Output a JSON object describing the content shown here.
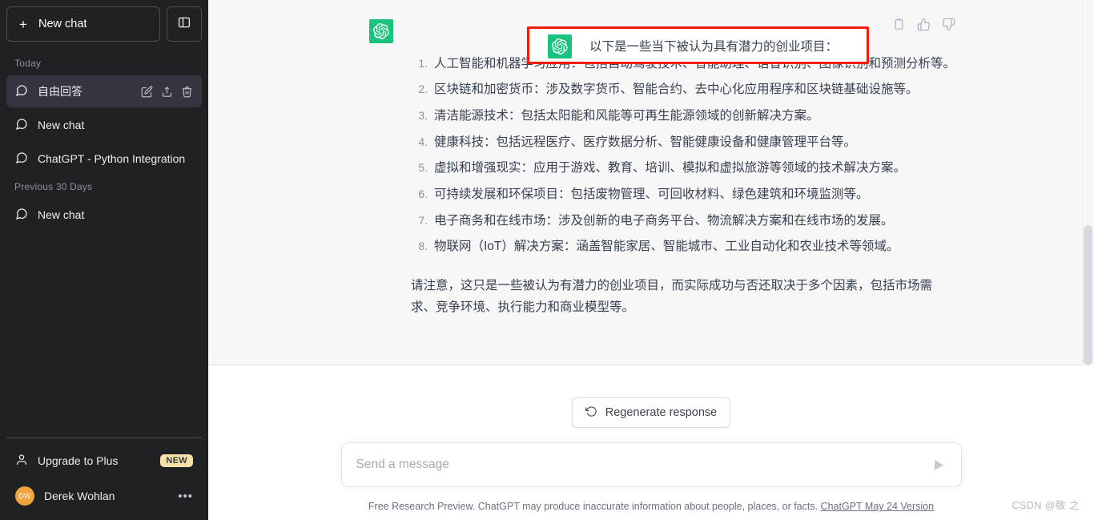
{
  "sidebar": {
    "new_chat_label": "New chat",
    "plus_icon": "+",
    "toggle_icon": "panel-left-icon",
    "groups": [
      {
        "label": "Today",
        "items": [
          {
            "title": "自由回答",
            "active": true
          },
          {
            "title": "New chat",
            "active": false
          },
          {
            "title": "ChatGPT - Python Integration",
            "active": false
          }
        ]
      },
      {
        "label": "Previous 30 Days",
        "items": [
          {
            "title": "New chat",
            "active": false
          }
        ]
      }
    ],
    "upgrade_label": "Upgrade to Plus",
    "badge_new": "NEW",
    "user_name": "Derek Wohlan",
    "user_initials": "DW",
    "user_menu_dots": "•••"
  },
  "message": {
    "author": "assistant",
    "avatar_color": "#19c37d",
    "lead": "以下是一些当下被认为具有潜力的创业项目：",
    "items": [
      "人工智能和机器学习应用：包括自动驾驶技术、智能助理、语音识别、图像识别和预测分析等。",
      "区块链和加密货币：涉及数字货币、智能合约、去中心化应用程序和区块链基础设施等。",
      "清洁能源技术：包括太阳能和风能等可再生能源领域的创新解决方案。",
      "健康科技：包括远程医疗、医疗数据分析、智能健康设备和健康管理平台等。",
      "虚拟和增强现实：应用于游戏、教育、培训、模拟和虚拟旅游等领域的技术解决方案。",
      "可持续发展和环保项目：包括废物管理、可回收材料、绿色建筑和环境监测等。",
      "电子商务和在线市场：涉及创新的电子商务平台、物流解决方案和在线市场的发展。",
      "物联网（IoT）解决方案：涵盖智能家居、智能城市、工业自动化和农业技术等领域。"
    ],
    "tail": "请注意，这只是一些被认为有潜力的创业项目，而实际成功与否还取决于多个因素，包括市场需求、竞争环境、执行能力和商业模型等。",
    "actions": [
      "copy-icon",
      "thumbs-up-icon",
      "thumbs-down-icon"
    ]
  },
  "annotation": {
    "color": "#f61a05",
    "target": "以下是一些当下被认为具有潜力的创业项目："
  },
  "composer": {
    "regenerate_label": "Regenerate response",
    "regenerate_icon": "refresh-icon",
    "placeholder": "Send a message",
    "value": "",
    "send_icon": "send-icon"
  },
  "footer": {
    "text": "Free Research Preview. ChatGPT may produce inaccurate information about people, places, or facts.",
    "link_text": "ChatGPT May 24 Version"
  },
  "watermark": "CSDN @敬 之",
  "colors": {
    "sidebar_bg": "#202123",
    "active_row": "#343541",
    "message_bg": "#f7f7f8",
    "brand_green": "#19c37d",
    "badge_bg": "#f6e2a8",
    "avatar_orange": "#f1a33c",
    "annotation_red": "#f61a05"
  }
}
